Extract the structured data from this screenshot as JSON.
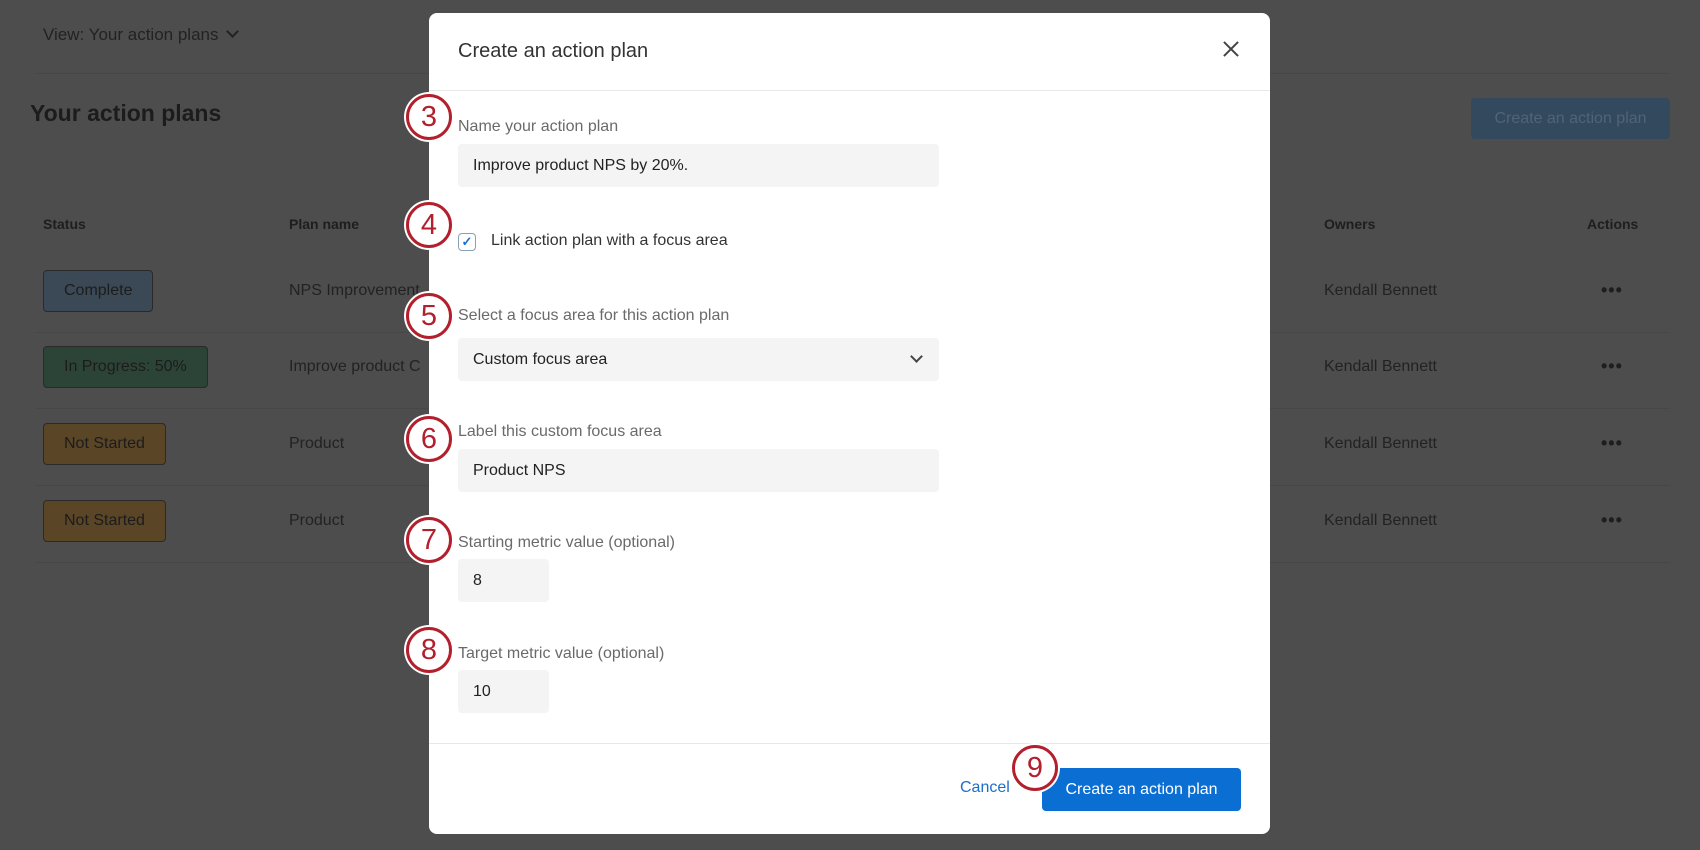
{
  "background": {
    "view_label": "View: Your action plans",
    "page_title": "Your action plans",
    "create_button": "Create an action plan",
    "columns": {
      "status": "Status",
      "plan_name": "Plan name",
      "owners": "Owners",
      "actions": "Actions"
    },
    "rows": [
      {
        "status": "Complete",
        "status_color": "#3b4956",
        "plan_name": "NPS Improvement",
        "owner": "Kendall Bennett",
        "actions": "•••"
      },
      {
        "status": "In Progress: 50%",
        "status_color": "#2c4438",
        "plan_name": "Improve product C",
        "owner": "Kendall Bennett",
        "actions": "•••"
      },
      {
        "status": "Not Started",
        "status_color": "#5a4526",
        "plan_name": "Product",
        "owner": "Kendall Bennett",
        "actions": "•••"
      },
      {
        "status": "Not Started",
        "status_color": "#5a4526",
        "plan_name": "Product",
        "owner": "Kendall Bennett",
        "actions": "•••"
      }
    ]
  },
  "modal": {
    "title": "Create an action plan",
    "name_label": "Name your action plan",
    "name_value": "Improve product NPS by 20%.",
    "link_checkbox_label": "Link action plan with a focus area",
    "link_checked": true,
    "focus_label": "Select a focus area for this action plan",
    "focus_value": "Custom focus area",
    "custom_label": "Label this custom focus area",
    "custom_value": "Product NPS",
    "start_label": "Starting metric value (optional)",
    "start_value": "8",
    "target_label": "Target metric value (optional)",
    "target_value": "10",
    "cancel": "Cancel",
    "create": "Create an action plan"
  },
  "steps": [
    "3",
    "4",
    "5",
    "6",
    "7",
    "8",
    "9"
  ],
  "colors": {
    "accent": "#0b6ed3",
    "step_red": "#b3202d"
  }
}
